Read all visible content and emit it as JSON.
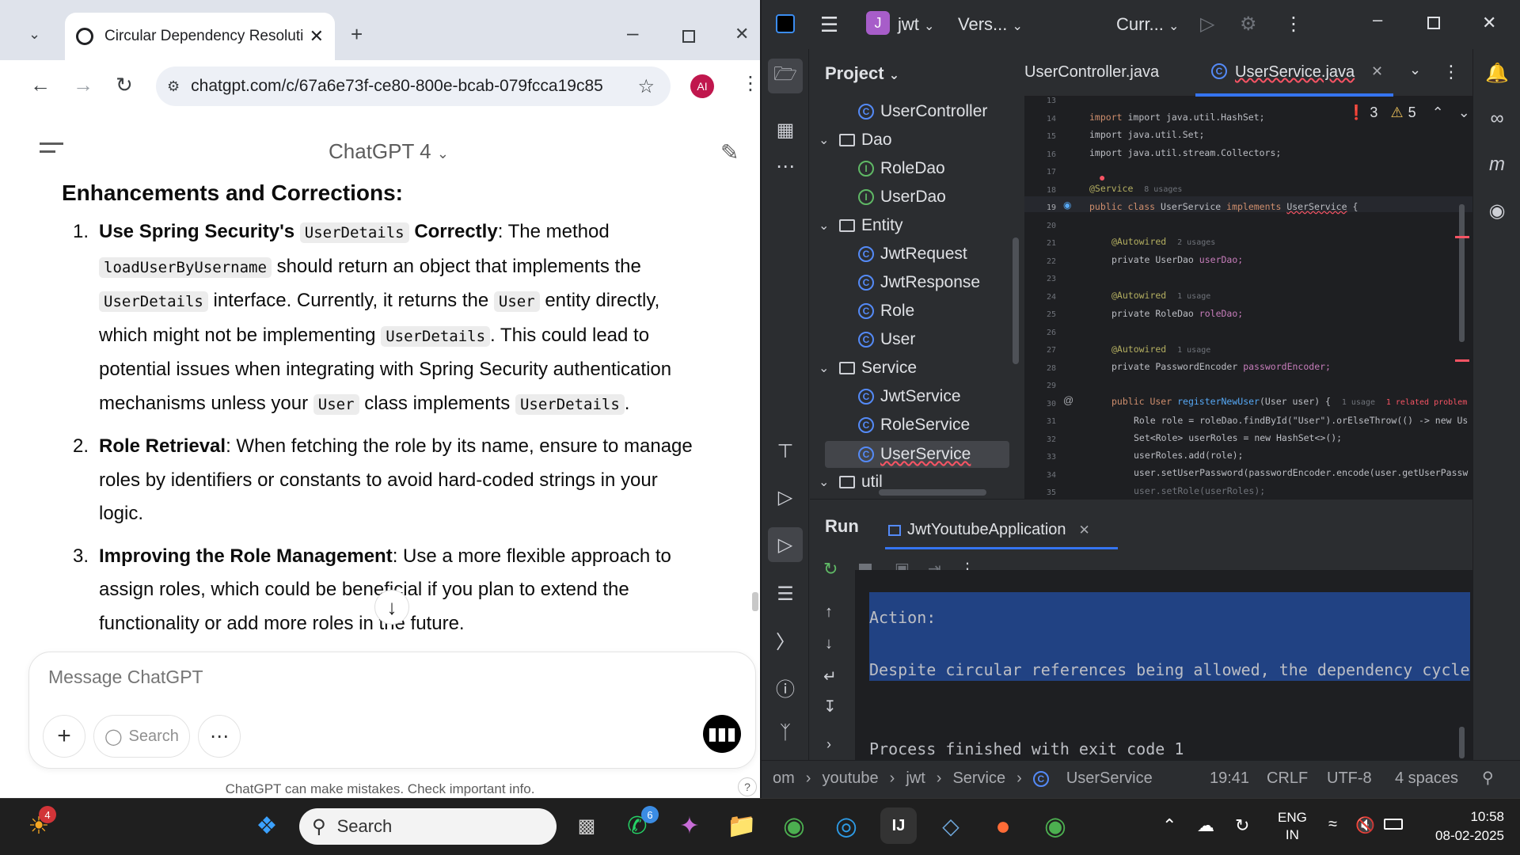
{
  "chrome": {
    "tab_title": "Circular Dependency Resolution",
    "url": "chatgpt.com/c/67a6e73f-ce80-800e-bcab-079fcca19c85",
    "profile": "AI"
  },
  "chatgpt": {
    "model": "ChatGPT 4",
    "heading": "Enhancements and Corrections:",
    "items": [
      {
        "num": "1.",
        "title": "Use Spring Security's",
        "code1": "UserDetails",
        "title2": "Correctly",
        "t1": ": The method",
        "code2": "loadUserByUsername",
        "t2": "should return an object that implements the",
        "code3": "UserDetails",
        "t3": "interface. Currently, it returns the",
        "code4": "User",
        "t4": "entity directly, which might not be implementing",
        "code5": "UserDetails",
        "t5": ". This could lead to potential issues when integrating with Spring Security authentication mechanisms unless your",
        "code6": "User",
        "t6": "class implements",
        "code7": "UserDetails",
        "t7": "."
      },
      {
        "num": "2.",
        "title": "Role Retrieval",
        "text": ": When fetching the role by its name, ensure to manage roles by identifiers or constants to avoid hard-coded strings in your logic."
      },
      {
        "num": "3.",
        "title": "Improving the Role Management",
        "text": ": Use a more flexible approach to assign roles, which could be beneficial if you plan to extend the functionality or add more roles in the future."
      }
    ],
    "composer_placeholder": "Message ChatGPT",
    "search_label": "Search",
    "disclaimer": "ChatGPT can make mistakes. Check important info.",
    "help": "?"
  },
  "ide": {
    "project_badge": "J",
    "project_name": "jwt",
    "vcs": "Vers...",
    "run_config": "Curr...",
    "panel_title": "Project",
    "tree": [
      {
        "label": "UserController",
        "type": "class"
      },
      {
        "label": "Dao",
        "type": "folder"
      },
      {
        "label": "RoleDao",
        "type": "interface"
      },
      {
        "label": "UserDao",
        "type": "interface"
      },
      {
        "label": "Entity",
        "type": "folder"
      },
      {
        "label": "JwtRequest",
        "type": "class"
      },
      {
        "label": "JwtResponse",
        "type": "class"
      },
      {
        "label": "Role",
        "type": "class"
      },
      {
        "label": "User",
        "type": "class"
      },
      {
        "label": "Service",
        "type": "folder"
      },
      {
        "label": "JwtService",
        "type": "class"
      },
      {
        "label": "RoleService",
        "type": "class"
      },
      {
        "label": "UserService",
        "type": "class"
      },
      {
        "label": "util",
        "type": "folder"
      }
    ],
    "tab1": "UserController.java",
    "tab2": "UserService.java",
    "errors": "3",
    "warnings": "5",
    "lines": [
      "13",
      "14",
      "15",
      "16",
      "17",
      "18",
      "19",
      "20",
      "21",
      "22",
      "23",
      "24",
      "25",
      "26",
      "27",
      "28",
      "29",
      "30",
      "31",
      "32",
      "33",
      "34",
      "35"
    ],
    "code": {
      "l14": "import java.util.HashSet;",
      "l15": "import java.util.Set;",
      "l16": "import java.util.stream.Collectors;",
      "l18a": "@Service",
      "l18b": "8 usages",
      "l19a": "public class",
      "l19b": "UserService",
      "l19c": "implements",
      "l19d": "UserService",
      "l19e": "{",
      "l21a": "@Autowired",
      "l21b": "2 usages",
      "l22a": "private UserDao",
      "l22b": "userDao;",
      "l24a": "@Autowired",
      "l24b": "1 usage",
      "l25a": "private RoleDao",
      "l25b": "roleDao;",
      "l27a": "@Autowired",
      "l27b": "1 usage",
      "l28a": "private PasswordEncoder",
      "l28b": "passwordEncoder;",
      "l30a": "public User",
      "l30b": "registerNewUser",
      "l30c": "(User user) {",
      "l30d": "1 usage",
      "l30e": "1 related problem",
      "l31": "Role role = roleDao.findById(\"User\").orElseThrow(() -> new Us",
      "l32": "Set<Role> userRoles = new HashSet<>();",
      "l33": "userRoles.add(role);",
      "l34": "user.setUserPassword(passwordEncoder.encode(user.getUserPassw",
      "l35": "user.setRole(userRoles);"
    },
    "run_title": "Run",
    "run_tab": "JwtYoutubeApplication",
    "console": {
      "action": "Action:",
      "message": "Despite circular references being allowed, the dependency cycle",
      "finished": "Process finished with exit code 1"
    },
    "status": {
      "crumbs": [
        "om",
        "youtube",
        "jwt",
        "Service",
        "UserService"
      ],
      "position": "19:41",
      "line_sep": "CRLF",
      "encoding": "UTF-8",
      "indent": "4 spaces"
    }
  },
  "taskbar": {
    "search": "Search",
    "weather_badge": "4",
    "whatsapp_badge": "6",
    "lang1": "ENG",
    "lang2": "IN",
    "time": "10:58",
    "date": "08-02-2025"
  }
}
